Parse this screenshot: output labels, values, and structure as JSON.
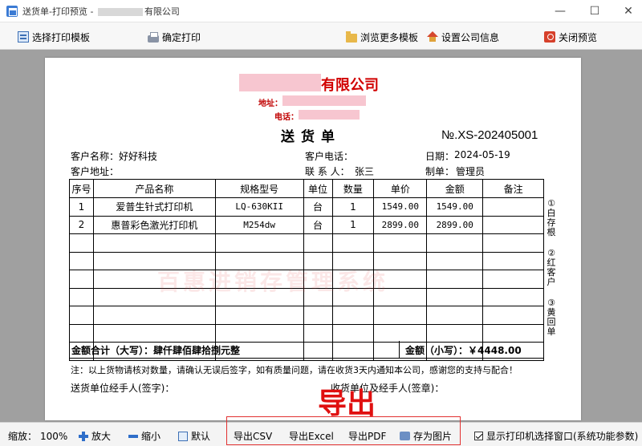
{
  "window": {
    "title_prefix": "送货单-打印预览 - ",
    "title_suffix": "有限公司",
    "minimize": "—",
    "maximize": "☐",
    "close": "✕"
  },
  "toolbar": {
    "select_template": "选择打印模板",
    "confirm_print": "确定打印",
    "browse_templates": "浏览更多模板",
    "company_info": "设置公司信息",
    "close_preview": "关闭预览"
  },
  "document": {
    "company_name": "有限公司",
    "address_label": "地址：",
    "phone_label": "电话：",
    "title": "送货单",
    "number": "№.XS-202405001",
    "customer_name_label": "客户名称：",
    "customer_name": "好好科技",
    "customer_phone_label": "客户电话：",
    "date_label": "日期：",
    "date": "2024-05-19",
    "customer_address_label": "客户地址：",
    "contact_label": "联 系 人：",
    "contact": "张三",
    "creator_label": "制单：",
    "creator": "管理员",
    "columns": [
      "序号",
      "产品名称",
      "规格型号",
      "单位",
      "数量",
      "单价",
      "金额",
      "备注"
    ],
    "rows": [
      [
        "1",
        "爱普生针式打印机",
        "LQ-630KII",
        "台",
        "1",
        "1549.00",
        "1549.00",
        ""
      ],
      [
        "2",
        "惠普彩色激光打印机",
        "M254dw",
        "台",
        "1",
        "2899.00",
        "2899.00",
        ""
      ]
    ],
    "total_upper_label": "金额合计（大写）：",
    "total_upper": "肆仟肆佰肆拾捌元整",
    "total_lower_label": "金额（小写）：",
    "total_lower": "￥4448.00",
    "copy_white": "①白存根",
    "copy_red": "②红客户",
    "copy_yellow": "③黄回单",
    "watermark": "百惠进销存管理系统",
    "note": "注：以上货物请核对数量，请确认无误后签字，如有质量问题，请在收货3天内通知本公司，感谢您的支持与配合！",
    "sender_sign": "送货单位经手人(签字)：",
    "receiver_sign": "收货单位及经手人(签章)："
  },
  "annotation": {
    "export_label": "导出"
  },
  "statusbar": {
    "zoom_label": "缩放：",
    "zoom_value": "100%",
    "zoom_in": "放大",
    "zoom_out": "缩小",
    "default": "默认",
    "export_csv": "导出CSV",
    "export_excel": "导出Excel",
    "export_pdf": "导出PDF",
    "save_image": "存为图片",
    "show_printer_dialog": "显示打印机选择窗口(系统功能参数)"
  }
}
